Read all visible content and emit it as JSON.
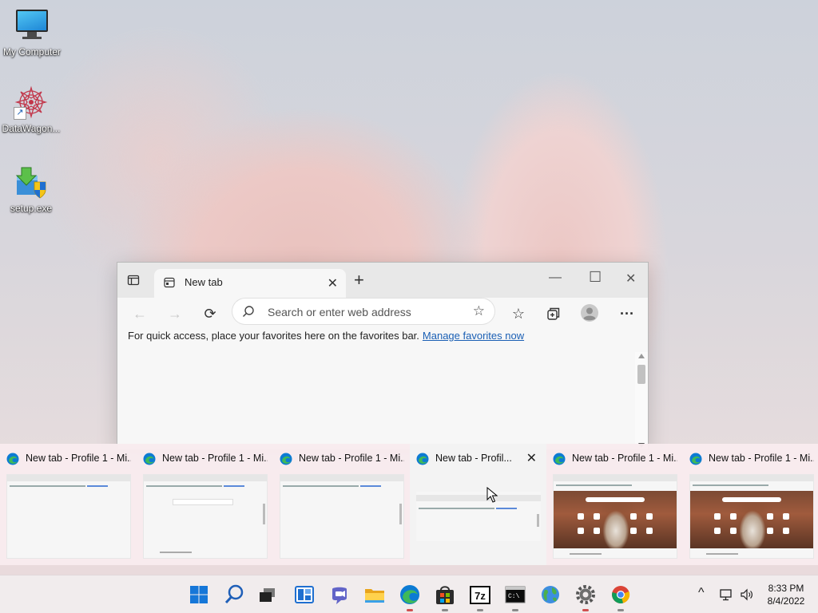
{
  "desktop": {
    "icons": [
      {
        "label": "My Computer"
      },
      {
        "label": "DataWagon..."
      },
      {
        "label": "setup.exe"
      }
    ]
  },
  "browser": {
    "tab_title": "New tab",
    "address_placeholder": "Search or enter web address",
    "favorites_message": "For quick access, place your favorites here on the favorites bar.",
    "favorites_link": "Manage favorites now"
  },
  "thumbnails": [
    {
      "title": "New tab - Profile 1 - Mi...",
      "kind": "plain"
    },
    {
      "title": "New tab - Profile 1 - Mi...",
      "kind": "search"
    },
    {
      "title": "New tab - Profile 1 - Mi...",
      "kind": "plain"
    },
    {
      "title": "New tab - Profil...",
      "kind": "active",
      "close": "✕"
    },
    {
      "title": "New tab - Profile 1 - Mi...",
      "kind": "photo"
    },
    {
      "title": "New tab - Profile 1 - Mi...",
      "kind": "photo"
    }
  ],
  "taskbar": {
    "apps": [
      "start",
      "search",
      "task-view",
      "widgets",
      "teams-chat",
      "file-explorer",
      "edge",
      "store",
      "7zip",
      "terminal",
      "network-globe",
      "settings",
      "chrome"
    ]
  },
  "clock": {
    "time": "8:33 PM",
    "date": "8/4/2022"
  },
  "colors": {
    "accent": "#1a5fb4",
    "edge_blue": "#0c7bd3",
    "edge_green": "#3fb95a"
  }
}
